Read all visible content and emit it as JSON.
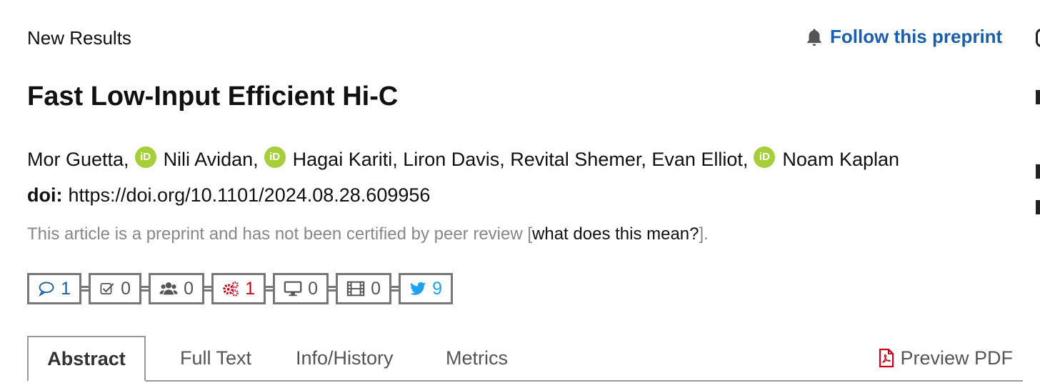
{
  "header": {
    "section_label": "New Results",
    "follow_label": "Follow this preprint"
  },
  "article": {
    "title": "Fast Low-Input Efficient Hi-C",
    "authors": [
      {
        "name": "Mor Guetta,",
        "orcid": true
      },
      {
        "name": "Nili Avidan,",
        "orcid": true
      },
      {
        "name": "Hagai Kariti, Liron Davis, Revital Shemer, Evan Elliot,",
        "orcid": true
      },
      {
        "name": "Noam Kaplan",
        "orcid": false
      }
    ],
    "orcid_label": "iD",
    "doi_label": "doi:",
    "doi_url": "https://doi.org/10.1101/2024.08.28.609956",
    "notice_text": "This article is a preprint and has not been certified by peer review [",
    "notice_link": "what does this mean?",
    "notice_end": "]."
  },
  "metrics": [
    {
      "icon": "comment-icon",
      "value": "1",
      "color": "#1a5fad"
    },
    {
      "icon": "check-square-icon",
      "value": "0",
      "color": "#555555"
    },
    {
      "icon": "users-icon",
      "value": "0",
      "color": "#555555"
    },
    {
      "icon": "gears-icon",
      "value": "1",
      "color": "#d0021b"
    },
    {
      "icon": "monitor-icon",
      "value": "0",
      "color": "#555555"
    },
    {
      "icon": "film-icon",
      "value": "0",
      "color": "#555555"
    },
    {
      "icon": "twitter-icon",
      "value": "9",
      "color": "#1da1f2"
    }
  ],
  "tabs": [
    {
      "label": "Abstract",
      "active": true
    },
    {
      "label": "Full Text",
      "active": false
    },
    {
      "label": "Info/History",
      "active": false
    },
    {
      "label": "Metrics",
      "active": false
    }
  ],
  "pdf_label": "Preview PDF",
  "colors": {
    "accent": "#1a5fad",
    "orcid": "#a6ce39",
    "alert": "#d0021b",
    "twitter": "#1da1f2"
  }
}
